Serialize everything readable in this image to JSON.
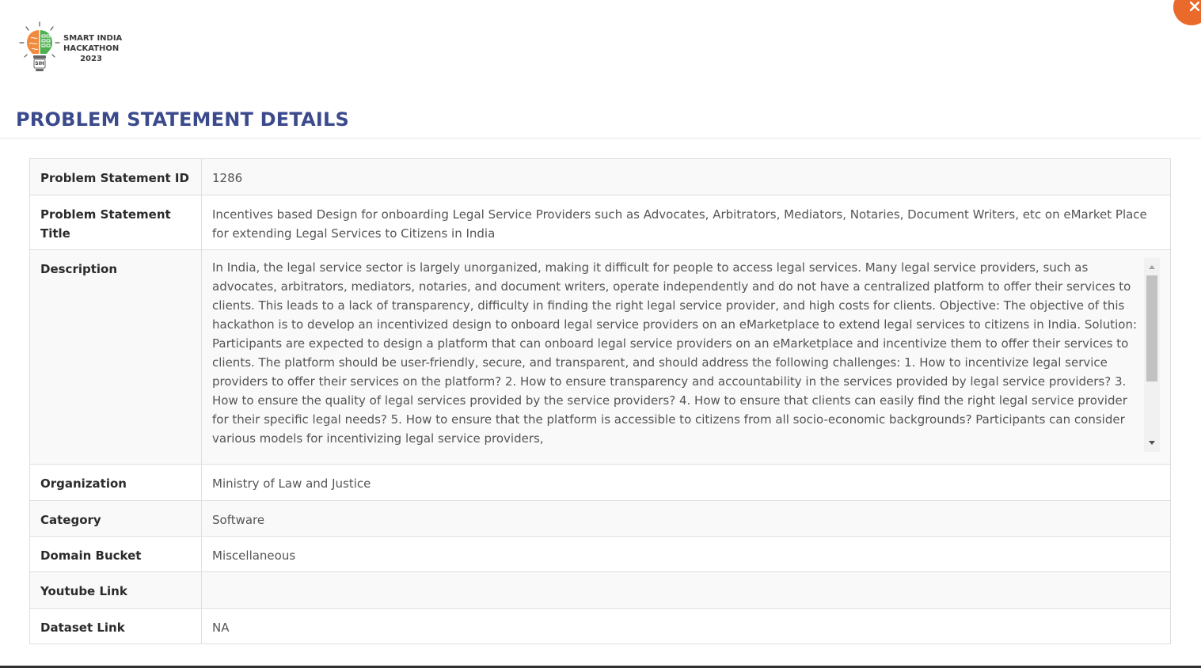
{
  "logo": {
    "lines": [
      "SMART INDIA",
      "HACKATHON",
      "2023"
    ],
    "badge": "SIH"
  },
  "close_icon": "close-icon",
  "page_title": "PROBLEM STATEMENT DETAILS",
  "details": {
    "id": {
      "label": "Problem Statement ID",
      "value": "1286"
    },
    "title": {
      "label": "Problem Statement Title",
      "value": "Incentives based Design for onboarding Legal Service Providers such as Advocates, Arbitrators, Mediators, Notaries, Document Writers, etc on eMarket Place for extending Legal Services to Citizens in India"
    },
    "description": {
      "label": "Description",
      "value": "In India, the legal service sector is largely unorganized, making it difficult for people to access legal services. Many legal service providers, such as advocates, arbitrators, mediators, notaries, and document writers, operate independently and do not have a centralized platform to offer their services to clients. This leads to a lack of transparency, difficulty in finding the right legal service provider, and high costs for clients. Objective: The objective of this hackathon is to develop an incentivized design to onboard legal service providers on an eMarketplace to extend legal services to citizens in India. Solution: Participants are expected to design a platform that can onboard legal service providers on an eMarketplace and incentivize them to offer their services to clients. The platform should be user-friendly, secure, and transparent, and should address the following challenges: 1. How to incentivize legal service providers to offer their services on the platform? 2. How to ensure transparency and accountability in the services provided by legal service providers? 3. How to ensure the quality of legal services provided by the service providers? 4. How to ensure that clients can easily find the right legal service provider for their specific legal needs? 5. How to ensure that the platform is accessible to citizens from all socio-economic backgrounds? Participants can consider various models for incentivizing legal service providers,"
    },
    "organization": {
      "label": "Organization",
      "value": "Ministry of Law and Justice"
    },
    "category": {
      "label": "Category",
      "value": "Software"
    },
    "domain": {
      "label": "Domain Bucket",
      "value": "Miscellaneous"
    },
    "youtube": {
      "label": "Youtube Link",
      "value": ""
    },
    "dataset": {
      "label": "Dataset Link",
      "value": "NA"
    }
  },
  "colors": {
    "title": "#3b4a8c",
    "close_button": "#ea6a2c",
    "logo_left": "#f08a3c",
    "logo_right": "#4caf50"
  }
}
